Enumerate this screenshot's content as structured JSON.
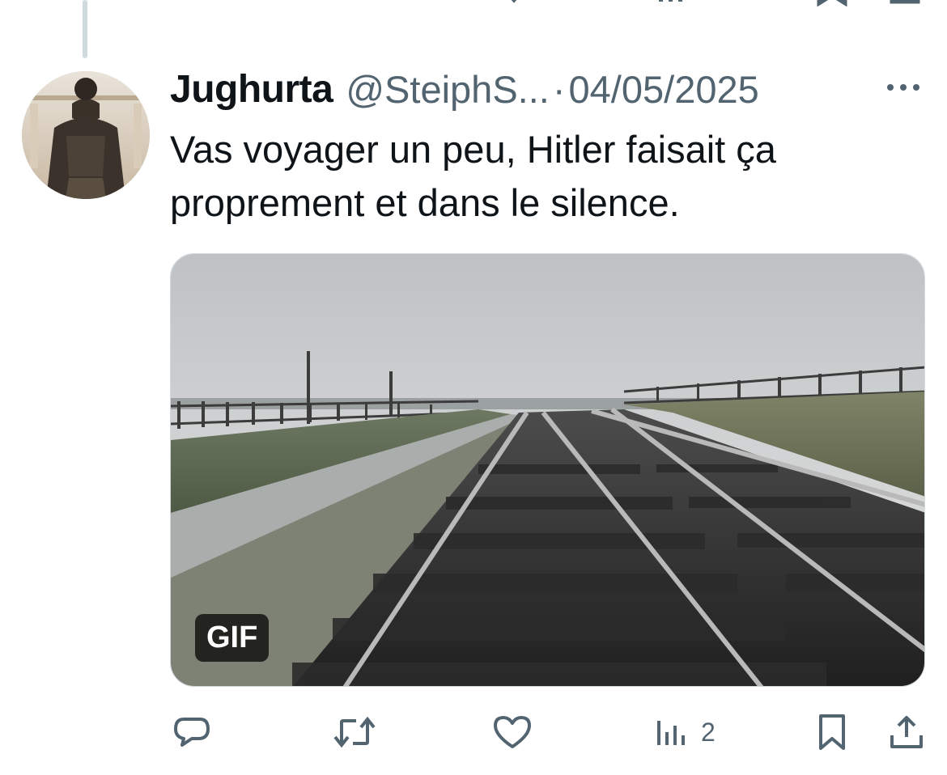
{
  "tweet": {
    "author_name": "Jughurta",
    "handle": "@SteiphS...",
    "separator": "·",
    "date": "04/05/2025",
    "text_lines": [
      "Vas voyager un peu, Hitler faisait ça",
      "proprement et dans le silence."
    ],
    "media": {
      "badge": "GIF"
    },
    "actions": {
      "reply": {
        "icon": "reply-icon"
      },
      "retweet": {
        "icon": "retweet-icon"
      },
      "like": {
        "icon": "heart-icon"
      },
      "views": {
        "icon": "views-icon",
        "count": "2"
      },
      "bookmark": {
        "icon": "bookmark-icon"
      },
      "share": {
        "icon": "share-icon"
      }
    }
  },
  "colors": {
    "secondary_text": "#536471",
    "primary_text": "#0f1419",
    "thread_line": "#cfd9de"
  }
}
